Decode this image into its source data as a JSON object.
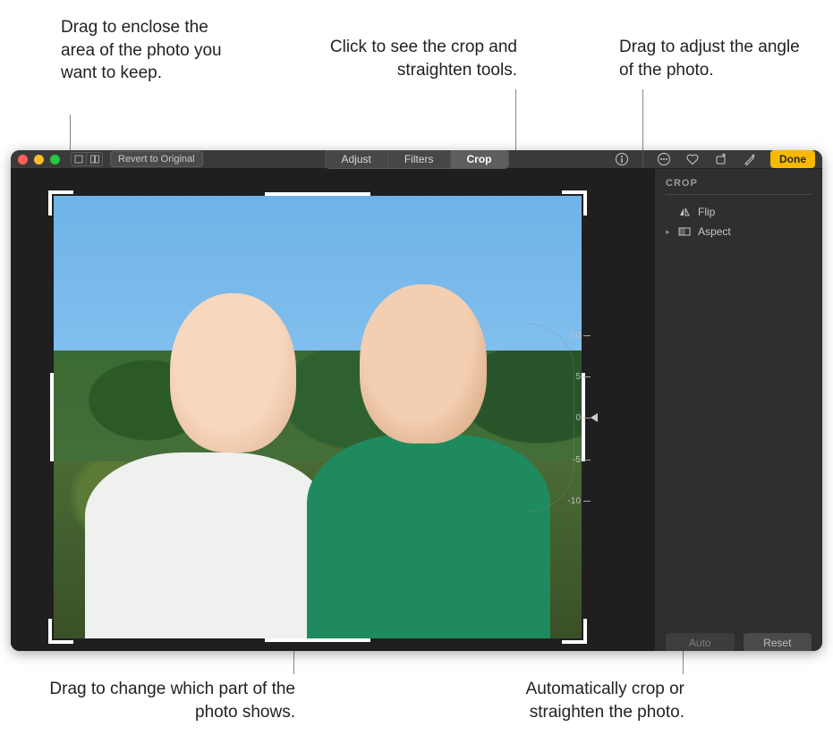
{
  "callouts": {
    "crop_handles": "Drag to enclose the area of the photo you want to keep.",
    "crop_tab": "Click to see the crop and straighten tools.",
    "angle_dial": "Drag to adjust the angle of the photo.",
    "pan_photo": "Drag to change which part of the photo shows.",
    "auto_btn": "Automatically crop or straighten the photo."
  },
  "toolbar": {
    "revert_label": "Revert to Original",
    "tabs": {
      "adjust": "Adjust",
      "filters": "Filters",
      "crop": "Crop"
    },
    "active_tab": "crop",
    "done_label": "Done"
  },
  "sidebar": {
    "title": "CROP",
    "flip_label": "Flip",
    "aspect_label": "Aspect",
    "auto_label": "Auto",
    "reset_label": "Reset"
  },
  "dial": {
    "ticks": [
      "10",
      "5",
      "0",
      "-5",
      "-10"
    ],
    "current": "0"
  }
}
